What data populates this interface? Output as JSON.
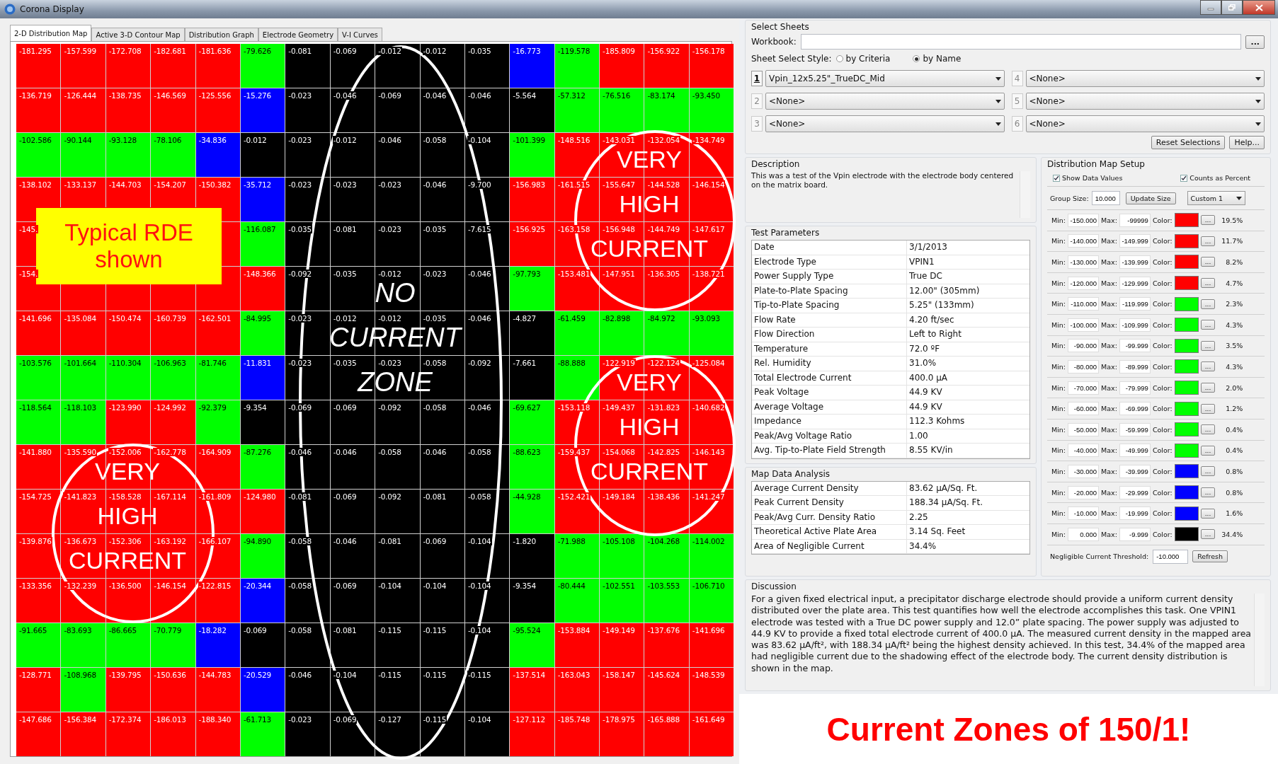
{
  "window": {
    "title": "Corona Display"
  },
  "tabs": [
    {
      "label": "2-D Distribution Map",
      "selected": true
    },
    {
      "label": "Active 3-D Contour Map",
      "selected": false
    },
    {
      "label": "Distribution Graph",
      "selected": false
    },
    {
      "label": "Electrode Geometry",
      "selected": false
    },
    {
      "label": "V-I Curves",
      "selected": false
    }
  ],
  "grid": {
    "rows": [
      [
        {
          "value": "-181.295",
          "color": "#ff0000"
        },
        {
          "value": "-157.599",
          "color": "#ff0000"
        },
        {
          "value": "-172.708",
          "color": "#ff0000"
        },
        {
          "value": "-182.681",
          "color": "#ff0000"
        },
        {
          "value": "-181.636",
          "color": "#ff0000"
        },
        {
          "value": "-79.626",
          "color": "#00ff00"
        },
        {
          "value": "-0.081",
          "color": "#000000"
        },
        {
          "value": "-0.069",
          "color": "#000000"
        },
        {
          "value": "-0.012",
          "color": "#000000"
        },
        {
          "value": "-0.012",
          "color": "#000000"
        },
        {
          "value": "-0.035",
          "color": "#000000"
        },
        {
          "value": "-16.773",
          "color": "#0000ff"
        },
        {
          "value": "-119.578",
          "color": "#00ff00"
        },
        {
          "value": "-185.809",
          "color": "#ff0000"
        },
        {
          "value": "-156.922",
          "color": "#ff0000"
        },
        {
          "value": "-156.178",
          "color": "#ff0000"
        }
      ],
      [
        {
          "value": "-136.719",
          "color": "#ff0000"
        },
        {
          "value": "-126.444",
          "color": "#ff0000"
        },
        {
          "value": "-138.735",
          "color": "#ff0000"
        },
        {
          "value": "-146.569",
          "color": "#ff0000"
        },
        {
          "value": "-125.556",
          "color": "#ff0000"
        },
        {
          "value": "-15.276",
          "color": "#0000ff"
        },
        {
          "value": "-0.023",
          "color": "#000000"
        },
        {
          "value": "-0.046",
          "color": "#000000"
        },
        {
          "value": "-0.069",
          "color": "#000000"
        },
        {
          "value": "-0.046",
          "color": "#000000"
        },
        {
          "value": "-0.046",
          "color": "#000000"
        },
        {
          "value": "-5.564",
          "color": "#000000"
        },
        {
          "value": "-57.312",
          "color": "#00ff00"
        },
        {
          "value": "-76.516",
          "color": "#00ff00"
        },
        {
          "value": "-83.174",
          "color": "#00ff00"
        },
        {
          "value": "-93.450",
          "color": "#00ff00"
        }
      ],
      [
        {
          "value": "-102.586",
          "color": "#00ff00"
        },
        {
          "value": "-90.144",
          "color": "#00ff00"
        },
        {
          "value": "-93.128",
          "color": "#00ff00"
        },
        {
          "value": "-78.106",
          "color": "#00ff00"
        },
        {
          "value": "-34.836",
          "color": "#0000ff"
        },
        {
          "value": "-0.012",
          "color": "#000000"
        },
        {
          "value": "-0.023",
          "color": "#000000"
        },
        {
          "value": "-0.012",
          "color": "#000000"
        },
        {
          "value": "-0.046",
          "color": "#000000"
        },
        {
          "value": "-0.058",
          "color": "#000000"
        },
        {
          "value": "-0.104",
          "color": "#000000"
        },
        {
          "value": "-101.399",
          "color": "#00ff00"
        },
        {
          "value": "-148.516",
          "color": "#ff0000"
        },
        {
          "value": "-143.031",
          "color": "#ff0000"
        },
        {
          "value": "-132.054",
          "color": "#ff0000"
        },
        {
          "value": "-134.749",
          "color": "#ff0000"
        }
      ],
      [
        {
          "value": "-138.102",
          "color": "#ff0000"
        },
        {
          "value": "-133.137",
          "color": "#ff0000"
        },
        {
          "value": "-144.703",
          "color": "#ff0000"
        },
        {
          "value": "-154.207",
          "color": "#ff0000"
        },
        {
          "value": "-150.382",
          "color": "#ff0000"
        },
        {
          "value": "-35.712",
          "color": "#0000ff"
        },
        {
          "value": "-0.023",
          "color": "#000000"
        },
        {
          "value": "-0.023",
          "color": "#000000"
        },
        {
          "value": "-0.023",
          "color": "#000000"
        },
        {
          "value": "-0.046",
          "color": "#000000"
        },
        {
          "value": "-9.700",
          "color": "#000000"
        },
        {
          "value": "-156.983",
          "color": "#ff0000"
        },
        {
          "value": "-161.515",
          "color": "#ff0000"
        },
        {
          "value": "-155.647",
          "color": "#ff0000"
        },
        {
          "value": "-144.528",
          "color": "#ff0000"
        },
        {
          "value": "-146.154",
          "color": "#ff0000"
        }
      ],
      [
        {
          "value": "-145.",
          "color": "#ff0000"
        },
        null,
        null,
        null,
        {
          "color": "#ff0000"
        },
        {
          "value": "-116.087",
          "color": "#00ff00"
        },
        {
          "value": "-0.035",
          "color": "#000000"
        },
        {
          "value": "-0.081",
          "color": "#000000"
        },
        {
          "value": "-0.023",
          "color": "#000000"
        },
        {
          "value": "-0.035",
          "color": "#000000"
        },
        {
          "value": "-7.615",
          "color": "#000000"
        },
        {
          "value": "-156.925",
          "color": "#ff0000"
        },
        {
          "value": "-163.158",
          "color": "#ff0000"
        },
        {
          "value": "-156.948",
          "color": "#ff0000"
        },
        {
          "value": "-144.749",
          "color": "#ff0000"
        },
        {
          "value": "-147.617",
          "color": "#ff0000"
        }
      ],
      [
        {
          "value": "-154.",
          "color": "#ff0000"
        },
        {
          "color": "#ff0000"
        },
        {
          "color": "#ff0000"
        },
        {
          "color": "#ff0000"
        },
        {
          "color": "#ff0000"
        },
        {
          "value": "-148.366",
          "color": "#ff0000"
        },
        {
          "value": "-0.092",
          "color": "#000000"
        },
        {
          "value": "-0.035",
          "color": "#000000"
        },
        {
          "value": "-0.012",
          "color": "#000000"
        },
        {
          "value": "-0.023",
          "color": "#000000"
        },
        {
          "value": "-0.046",
          "color": "#000000"
        },
        {
          "value": "-97.793",
          "color": "#00ff00"
        },
        {
          "value": "-153.481",
          "color": "#ff0000"
        },
        {
          "value": "-147.951",
          "color": "#ff0000"
        },
        {
          "value": "-136.305",
          "color": "#ff0000"
        },
        {
          "value": "-138.721",
          "color": "#ff0000"
        }
      ],
      [
        {
          "value": "-141.696",
          "color": "#ff0000"
        },
        {
          "value": "-135.084",
          "color": "#ff0000"
        },
        {
          "value": "-150.474",
          "color": "#ff0000"
        },
        {
          "value": "-160.739",
          "color": "#ff0000"
        },
        {
          "value": "-162.501",
          "color": "#ff0000"
        },
        {
          "value": "-84.995",
          "color": "#00ff00"
        },
        {
          "value": "-0.023",
          "color": "#000000"
        },
        {
          "value": "-0.012",
          "color": "#000000"
        },
        {
          "value": "-0.012",
          "color": "#000000"
        },
        {
          "value": "-0.035",
          "color": "#000000"
        },
        {
          "value": "-0.046",
          "color": "#000000"
        },
        {
          "value": "-4.827",
          "color": "#000000"
        },
        {
          "value": "-61.459",
          "color": "#00ff00"
        },
        {
          "value": "-82.898",
          "color": "#00ff00"
        },
        {
          "value": "-84.972",
          "color": "#00ff00"
        },
        {
          "value": "-93.093",
          "color": "#00ff00"
        }
      ],
      [
        {
          "value": "-103.576",
          "color": "#00ff00"
        },
        {
          "value": "-101.664",
          "color": "#00ff00"
        },
        {
          "value": "-110.304",
          "color": "#00ff00"
        },
        {
          "value": "-106.963",
          "color": "#00ff00"
        },
        {
          "value": "-81.746",
          "color": "#00ff00"
        },
        {
          "value": "-11.831",
          "color": "#0000ff"
        },
        {
          "value": "-0.023",
          "color": "#000000"
        },
        {
          "value": "-0.035",
          "color": "#000000"
        },
        {
          "value": "-0.023",
          "color": "#000000"
        },
        {
          "value": "-0.058",
          "color": "#000000"
        },
        {
          "value": "-0.092",
          "color": "#000000"
        },
        {
          "value": "-7.661",
          "color": "#000000"
        },
        {
          "value": "-88.888",
          "color": "#00ff00"
        },
        {
          "value": "-122.919",
          "color": "#ff0000"
        },
        {
          "value": "-122.124",
          "color": "#ff0000"
        },
        {
          "value": "-125.084",
          "color": "#ff0000"
        }
      ],
      [
        {
          "value": "-118.564",
          "color": "#00ff00"
        },
        {
          "value": "-118.103",
          "color": "#00ff00"
        },
        {
          "value": "-123.990",
          "color": "#ff0000"
        },
        {
          "value": "-124.992",
          "color": "#ff0000"
        },
        {
          "value": "-92.379",
          "color": "#00ff00"
        },
        {
          "value": "-9.354",
          "color": "#000000"
        },
        {
          "value": "-0.069",
          "color": "#000000"
        },
        {
          "value": "-0.069",
          "color": "#000000"
        },
        {
          "value": "-0.092",
          "color": "#000000"
        },
        {
          "value": "-0.058",
          "color": "#000000"
        },
        {
          "value": "-0.046",
          "color": "#000000"
        },
        {
          "value": "-69.627",
          "color": "#00ff00"
        },
        {
          "value": "-153.118",
          "color": "#ff0000"
        },
        {
          "value": "-149.437",
          "color": "#ff0000"
        },
        {
          "value": "-131.823",
          "color": "#ff0000"
        },
        {
          "value": "-140.682",
          "color": "#ff0000"
        }
      ],
      [
        {
          "value": "-141.880",
          "color": "#ff0000"
        },
        {
          "value": "-135.590",
          "color": "#ff0000"
        },
        {
          "value": "-152.006",
          "color": "#ff0000"
        },
        {
          "value": "-162.778",
          "color": "#ff0000"
        },
        {
          "value": "-164.909",
          "color": "#ff0000"
        },
        {
          "value": "-87.276",
          "color": "#00ff00"
        },
        {
          "value": "-0.046",
          "color": "#000000"
        },
        {
          "value": "-0.046",
          "color": "#000000"
        },
        {
          "value": "-0.058",
          "color": "#000000"
        },
        {
          "value": "-0.046",
          "color": "#000000"
        },
        {
          "value": "-0.058",
          "color": "#000000"
        },
        {
          "value": "-88.623",
          "color": "#00ff00"
        },
        {
          "value": "-159.437",
          "color": "#ff0000"
        },
        {
          "value": "-154.068",
          "color": "#ff0000"
        },
        {
          "value": "-142.825",
          "color": "#ff0000"
        },
        {
          "value": "-146.143",
          "color": "#ff0000"
        }
      ],
      [
        {
          "value": "-154.725",
          "color": "#ff0000"
        },
        {
          "value": "-141.823",
          "color": "#ff0000"
        },
        {
          "value": "-158.528",
          "color": "#ff0000"
        },
        {
          "value": "-167.114",
          "color": "#ff0000"
        },
        {
          "value": "-161.809",
          "color": "#ff0000"
        },
        {
          "value": "-124.980",
          "color": "#ff0000"
        },
        {
          "value": "-0.081",
          "color": "#000000"
        },
        {
          "value": "-0.069",
          "color": "#000000"
        },
        {
          "value": "-0.092",
          "color": "#000000"
        },
        {
          "value": "-0.081",
          "color": "#000000"
        },
        {
          "value": "-0.058",
          "color": "#000000"
        },
        {
          "value": "-44.928",
          "color": "#00ff00"
        },
        {
          "value": "-152.421",
          "color": "#ff0000"
        },
        {
          "value": "-149.184",
          "color": "#ff0000"
        },
        {
          "value": "-138.436",
          "color": "#ff0000"
        },
        {
          "value": "-141.247",
          "color": "#ff0000"
        }
      ],
      [
        {
          "value": "-139.876",
          "color": "#ff0000"
        },
        {
          "value": "-136.673",
          "color": "#ff0000"
        },
        {
          "value": "-152.306",
          "color": "#ff0000"
        },
        {
          "value": "-163.192",
          "color": "#ff0000"
        },
        {
          "value": "-166.107",
          "color": "#ff0000"
        },
        {
          "value": "-94.890",
          "color": "#00ff00"
        },
        {
          "value": "-0.058",
          "color": "#000000"
        },
        {
          "value": "-0.046",
          "color": "#000000"
        },
        {
          "value": "-0.081",
          "color": "#000000"
        },
        {
          "value": "-0.069",
          "color": "#000000"
        },
        {
          "value": "-0.104",
          "color": "#000000"
        },
        {
          "value": "-1.820",
          "color": "#000000"
        },
        {
          "value": "-71.988",
          "color": "#00ff00"
        },
        {
          "value": "-105.108",
          "color": "#00ff00"
        },
        {
          "value": "-104.268",
          "color": "#00ff00"
        },
        {
          "value": "-114.002",
          "color": "#00ff00"
        }
      ],
      [
        {
          "value": "-133.356",
          "color": "#ff0000"
        },
        {
          "value": "-132.239",
          "color": "#ff0000"
        },
        {
          "value": "-136.500",
          "color": "#ff0000"
        },
        {
          "value": "-146.154",
          "color": "#ff0000"
        },
        {
          "value": "-122.815",
          "color": "#ff0000"
        },
        {
          "value": "-20.344",
          "color": "#0000ff"
        },
        {
          "value": "-0.058",
          "color": "#000000"
        },
        {
          "value": "-0.069",
          "color": "#000000"
        },
        {
          "value": "-0.104",
          "color": "#000000"
        },
        {
          "value": "-0.104",
          "color": "#000000"
        },
        {
          "value": "-0.104",
          "color": "#000000"
        },
        {
          "value": "-9.354",
          "color": "#000000"
        },
        {
          "value": "-80.444",
          "color": "#00ff00"
        },
        {
          "value": "-102.551",
          "color": "#00ff00"
        },
        {
          "value": "-103.553",
          "color": "#00ff00"
        },
        {
          "value": "-106.710",
          "color": "#00ff00"
        }
      ],
      [
        {
          "value": "-91.665",
          "color": "#00ff00"
        },
        {
          "value": "-83.693",
          "color": "#00ff00"
        },
        {
          "value": "-86.665",
          "color": "#00ff00"
        },
        {
          "value": "-70.779",
          "color": "#00ff00"
        },
        {
          "value": "-18.282",
          "color": "#0000ff"
        },
        {
          "value": "-0.069",
          "color": "#000000"
        },
        {
          "value": "-0.058",
          "color": "#000000"
        },
        {
          "value": "-0.081",
          "color": "#000000"
        },
        {
          "value": "-0.115",
          "color": "#000000"
        },
        {
          "value": "-0.115",
          "color": "#000000"
        },
        {
          "value": "-0.104",
          "color": "#000000"
        },
        {
          "value": "-95.524",
          "color": "#00ff00"
        },
        {
          "value": "-153.884",
          "color": "#ff0000"
        },
        {
          "value": "-149.149",
          "color": "#ff0000"
        },
        {
          "value": "-137.676",
          "color": "#ff0000"
        },
        {
          "value": "-141.696",
          "color": "#ff0000"
        }
      ],
      [
        {
          "value": "-128.771",
          "color": "#ff0000"
        },
        {
          "value": "-108.968",
          "color": "#00ff00"
        },
        {
          "value": "-139.795",
          "color": "#ff0000"
        },
        {
          "value": "-150.636",
          "color": "#ff0000"
        },
        {
          "value": "-144.783",
          "color": "#ff0000"
        },
        {
          "value": "-20.529",
          "color": "#0000ff"
        },
        {
          "value": "-0.046",
          "color": "#000000"
        },
        {
          "value": "-0.104",
          "color": "#000000"
        },
        {
          "value": "-0.115",
          "color": "#000000"
        },
        {
          "value": "-0.115",
          "color": "#000000"
        },
        {
          "value": "-0.115",
          "color": "#000000"
        },
        {
          "value": "-137.514",
          "color": "#ff0000"
        },
        {
          "value": "-163.043",
          "color": "#ff0000"
        },
        {
          "value": "-158.147",
          "color": "#ff0000"
        },
        {
          "value": "-145.624",
          "color": "#ff0000"
        },
        {
          "value": "-148.539",
          "color": "#ff0000"
        }
      ],
      [
        {
          "value": "-147.686",
          "color": "#ff0000"
        },
        {
          "value": "-156.384",
          "color": "#ff0000"
        },
        {
          "value": "-172.374",
          "color": "#ff0000"
        },
        {
          "value": "-186.013",
          "color": "#ff0000"
        },
        {
          "value": "-188.340",
          "color": "#ff0000"
        },
        {
          "value": "-61.713",
          "color": "#00ff00"
        },
        {
          "value": "-0.023",
          "color": "#000000"
        },
        {
          "value": "-0.069",
          "color": "#000000"
        },
        {
          "value": "-0.127",
          "color": "#000000"
        },
        {
          "value": "-0.115",
          "color": "#000000"
        },
        {
          "value": "-0.104",
          "color": "#000000"
        },
        {
          "value": "-127.112",
          "color": "#ff0000"
        },
        {
          "value": "-185.748",
          "color": "#ff0000"
        },
        {
          "value": "-178.975",
          "color": "#ff0000"
        },
        {
          "value": "-165.888",
          "color": "#ff0000"
        },
        {
          "value": "-161.649",
          "color": "#ff0000"
        }
      ]
    ]
  },
  "annotations": [
    {
      "kind": "box",
      "lines": [
        "Typical RDE",
        "shown"
      ]
    },
    {
      "kind": "circle",
      "lines": [
        "VERY",
        "HIGH",
        "CURRENT"
      ]
    },
    {
      "kind": "ellipse",
      "lines": [
        "NO",
        "CURRENT",
        "ZONE"
      ]
    },
    {
      "kind": "circle",
      "lines": [
        "VERY",
        "HIGH",
        "CURRENT"
      ]
    },
    {
      "kind": "circle",
      "lines": [
        "VERY",
        "HIGH",
        "CURRENT"
      ]
    }
  ],
  "select_sheets": {
    "title": "Select Sheets",
    "workbook_label": "Workbook:",
    "browse_button": "...",
    "style_label": "Sheet Select Style:",
    "styles": [
      {
        "label": "by Criteria",
        "selected": false
      },
      {
        "label": "by Name",
        "selected": true
      }
    ],
    "sheets": [
      {
        "number": "1",
        "value": "Vpin_12x5.25\"_TrueDC_Mid",
        "selected": true
      },
      {
        "number": "2",
        "value": "<None>",
        "selected": false
      },
      {
        "number": "3",
        "value": "<None>",
        "selected": false
      },
      {
        "number": "4",
        "value": "<None>",
        "selected": false
      },
      {
        "number": "5",
        "value": "<None>",
        "selected": false
      },
      {
        "number": "6",
        "value": "<None>",
        "selected": false
      }
    ],
    "buttons": [
      "Reset Selections",
      "Help..."
    ]
  },
  "description": {
    "title": "Description",
    "text": "This was a test of the Vpin electrode with the electrode body centered on the matrix board."
  },
  "test_parameters": {
    "title": "Test Parameters",
    "rows": [
      {
        "name": "Date",
        "value": "3/1/2013"
      },
      {
        "name": "Electrode Type",
        "value": "VPIN1"
      },
      {
        "name": "Power Supply Type",
        "value": "True DC"
      },
      {
        "name": "Plate-to-Plate Spacing",
        "value": "12.00\" (305mm)"
      },
      {
        "name": "Tip-to-Plate Spacing",
        "value": "5.25\" (133mm)"
      },
      {
        "name": "Flow Rate",
        "value": "4.20 ft/sec"
      },
      {
        "name": "Flow Direction",
        "value": "Left to Right"
      },
      {
        "name": "Temperature",
        "value": "72.0 ºF"
      },
      {
        "name": "Rel. Humidity",
        "value": "31.0%"
      },
      {
        "name": "Total Electrode Current",
        "value": "400.0 µA"
      },
      {
        "name": "Peak Voltage",
        "value": "44.9 KV"
      },
      {
        "name": "Average Voltage",
        "value": "44.9 KV"
      },
      {
        "name": "Impedance",
        "value": "112.3 Kohms"
      },
      {
        "name": "Peak/Avg Voltage Ratio",
        "value": "1.00"
      },
      {
        "name": "Avg. Tip-to-Plate Field Strength",
        "value": "8.55 KV/in"
      }
    ]
  },
  "map_data_analysis": {
    "title": "Map Data Analysis",
    "rows": [
      {
        "name": "Average Current Density",
        "value": "83.62 µA/Sq. Ft."
      },
      {
        "name": "Peak Current Density",
        "value": "188.34 µA/Sq. Ft."
      },
      {
        "name": "Peak/Avg Curr. Density Ratio",
        "value": "2.25"
      },
      {
        "name": "Theoretical Active Plate Area",
        "value": "3.14 Sq. Feet"
      },
      {
        "name": "Area of Negligible Current",
        "value": "34.4%"
      }
    ]
  },
  "distribution_map_setup": {
    "title": "Distribution Map Setup",
    "checkboxes": [
      {
        "label": "Show Data Values",
        "checked": true
      },
      {
        "label": "Counts as Percent",
        "checked": true
      }
    ],
    "group_size_label": "Group Size:",
    "group_size": "10.000",
    "update_button": "Update Size",
    "scheme": "Custom 1",
    "ranges": [
      {
        "min_label": "Min:",
        "min": "-150.000",
        "max_label": "Max:",
        "max": "-99999",
        "color_label": "Color:",
        "color": "#ff0000",
        "button": "...",
        "percent": "19.5%"
      },
      {
        "min_label": "Min:",
        "min": "-140.000",
        "max_label": "Max:",
        "max": "-149.999",
        "color_label": "Color:",
        "color": "#ff0000",
        "button": "...",
        "percent": "11.7%"
      },
      {
        "min_label": "Min:",
        "min": "-130.000",
        "max_label": "Max:",
        "max": "-139.999",
        "color_label": "Color:",
        "color": "#ff0000",
        "button": "...",
        "percent": "8.2%"
      },
      {
        "min_label": "Min:",
        "min": "-120.000",
        "max_label": "Max:",
        "max": "-129.999",
        "color_label": "Color:",
        "color": "#ff0000",
        "button": "...",
        "percent": "4.7%"
      },
      {
        "min_label": "Min:",
        "min": "-110.000",
        "max_label": "Max:",
        "max": "-119.999",
        "color_label": "Color:",
        "color": "#00ff00",
        "button": "...",
        "percent": "2.3%"
      },
      {
        "min_label": "Min:",
        "min": "-100.000",
        "max_label": "Max:",
        "max": "-109.999",
        "color_label": "Color:",
        "color": "#00ff00",
        "button": "...",
        "percent": "4.3%"
      },
      {
        "min_label": "Min:",
        "min": "-90.000",
        "max_label": "Max:",
        "max": "-99.999",
        "color_label": "Color:",
        "color": "#00ff00",
        "button": "...",
        "percent": "3.5%"
      },
      {
        "min_label": "Min:",
        "min": "-80.000",
        "max_label": "Max:",
        "max": "-89.999",
        "color_label": "Color:",
        "color": "#00ff00",
        "button": "...",
        "percent": "4.3%"
      },
      {
        "min_label": "Min:",
        "min": "-70.000",
        "max_label": "Max:",
        "max": "-79.999",
        "color_label": "Color:",
        "color": "#00ff00",
        "button": "...",
        "percent": "2.0%"
      },
      {
        "min_label": "Min:",
        "min": "-60.000",
        "max_label": "Max:",
        "max": "-69.999",
        "color_label": "Color:",
        "color": "#00ff00",
        "button": "...",
        "percent": "1.2%"
      },
      {
        "min_label": "Min:",
        "min": "-50.000",
        "max_label": "Max:",
        "max": "-59.999",
        "color_label": "Color:",
        "color": "#00ff00",
        "button": "...",
        "percent": "0.4%"
      },
      {
        "min_label": "Min:",
        "min": "-40.000",
        "max_label": "Max:",
        "max": "-49.999",
        "color_label": "Color:",
        "color": "#00ff00",
        "button": "...",
        "percent": "0.4%"
      },
      {
        "min_label": "Min:",
        "min": "-30.000",
        "max_label": "Max:",
        "max": "-39.999",
        "color_label": "Color:",
        "color": "#0000ff",
        "button": "...",
        "percent": "0.8%"
      },
      {
        "min_label": "Min:",
        "min": "-20.000",
        "max_label": "Max:",
        "max": "-29.999",
        "color_label": "Color:",
        "color": "#0000ff",
        "button": "...",
        "percent": "0.8%"
      },
      {
        "min_label": "Min:",
        "min": "-10.000",
        "max_label": "Max:",
        "max": "-19.999",
        "color_label": "Color:",
        "color": "#0000ff",
        "button": "...",
        "percent": "1.6%"
      },
      {
        "min_label": "Min:",
        "min": "0.000",
        "max_label": "Max:",
        "max": "-9.999",
        "color_label": "Color:",
        "color": "#000000",
        "button": "...",
        "percent": "34.4%"
      }
    ],
    "threshold_label": "Negligible Current Threshold:",
    "threshold": "-10.000",
    "refresh_button": "Refresh"
  },
  "discussion": {
    "title": "Discussion",
    "text": "For a given fixed electrical input, a precipitator discharge electrode should provide a uniform current density distributed over the plate area.  This test quantifies how well the electrode accomplishes this task. One VPIN1 electrode was tested with a True DC power supply and 12.0” plate spacing.  The power supply was adjusted to 44.9 KV to provide a fixed total electrode current of 400.0 µA.  The measured current density in the mapped area was 83.62 µA/ft², with 188.34 µA/ft² being the highest density achieved. In this test, 34.4% of the mapped area had negligible current due to the shadowing effect of the electrode body.  The current density distribution is shown in the map."
  },
  "caption": "Current Zones of 150/1!"
}
